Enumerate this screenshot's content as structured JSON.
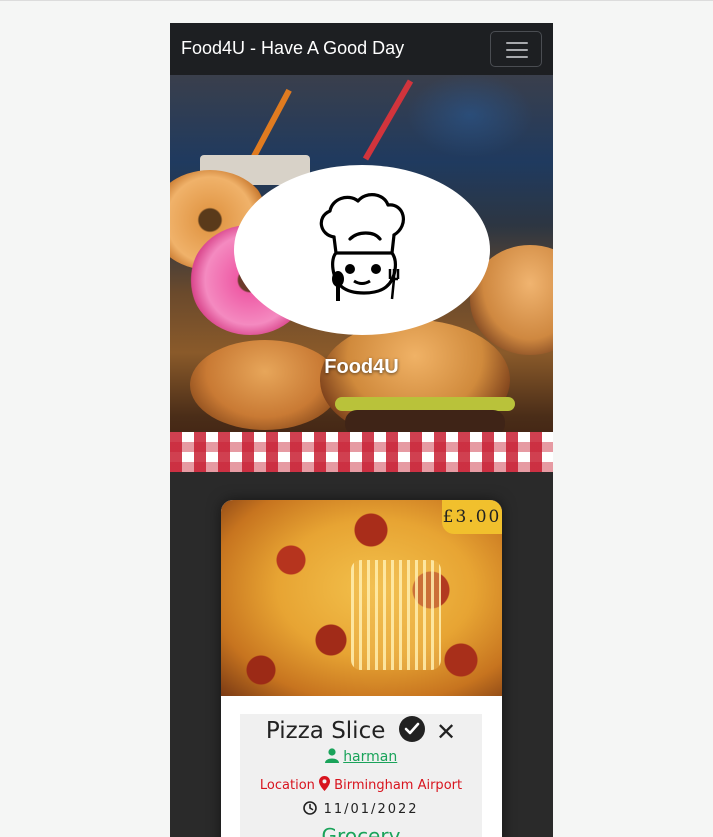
{
  "navbar": {
    "brand": "Food4U - Have A Good Day",
    "toggler_icon": "hamburger-menu-icon"
  },
  "hero": {
    "title": "Food4U",
    "logo_icon": "chef-hat-logo-icon"
  },
  "listing": {
    "price": "£3.00",
    "title": "Pizza Slice",
    "verified_icon": "check-circle-icon",
    "remove_icon": "close-icon",
    "user_icon": "user-icon",
    "user": "harman",
    "location_label": "Location",
    "location_icon": "map-pin-icon",
    "location": "Birmingham Airport",
    "clock_icon": "clock-icon",
    "date": "11/01/2022",
    "category": "Grocery"
  },
  "colors": {
    "navbar_bg": "#1d1f22",
    "page_bg": "#2a2a2a",
    "price_bg": "#f1c02d",
    "user_green": "#1aa35a",
    "location_red": "#d8141e"
  }
}
